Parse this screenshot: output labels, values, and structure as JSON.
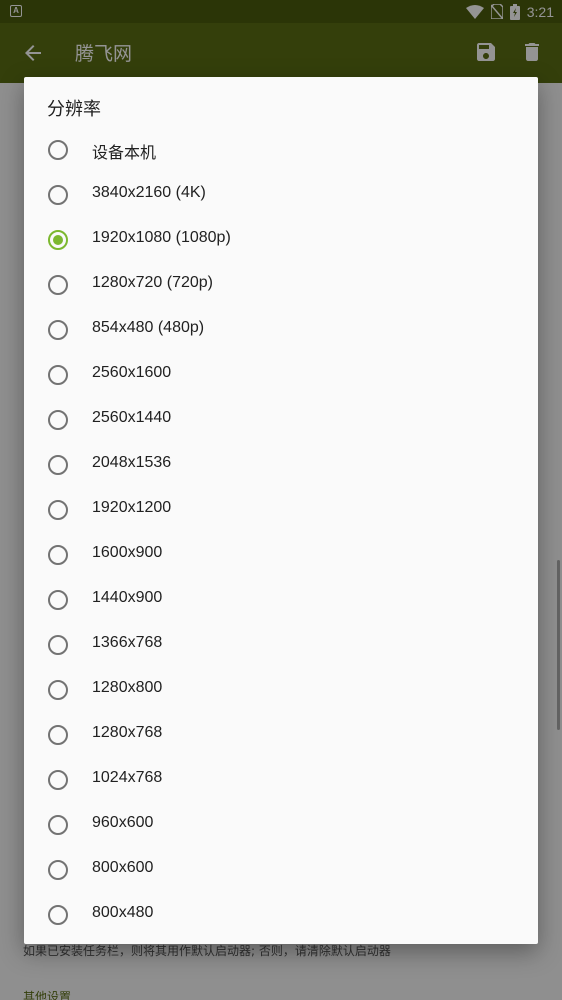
{
  "status_bar": {
    "time": "3:21",
    "icons": [
      "app-notification-icon",
      "wifi-icon",
      "no-sim-icon",
      "battery-icon"
    ]
  },
  "app_bar": {
    "title": "腾飞网",
    "icons": [
      "back-arrow-icon",
      "save-icon",
      "delete-icon"
    ]
  },
  "background": {
    "footer_text": "如果已安装任务栏，则将其用作默认启动器; 否则，请清除默认启动器",
    "section_header": "其他设置"
  },
  "dialog": {
    "title": "分辨率",
    "selected_index": 2,
    "options": [
      "设备本机",
      "3840x2160 (4K)",
      "1920x1080 (1080p)",
      "1280x720 (720p)",
      "854x480 (480p)",
      "2560x1600",
      "2560x1440",
      "2048x1536",
      "1920x1200",
      "1600x900",
      "1440x900",
      "1366x768",
      "1280x800",
      "1280x768",
      "1024x768",
      "960x600",
      "800x600",
      "800x480"
    ]
  },
  "colors": {
    "status_bar": "#4b5c0d",
    "app_bar": "#5a6d14",
    "radio_checked": "#7cb82f",
    "radio_unchecked": "#737373"
  }
}
